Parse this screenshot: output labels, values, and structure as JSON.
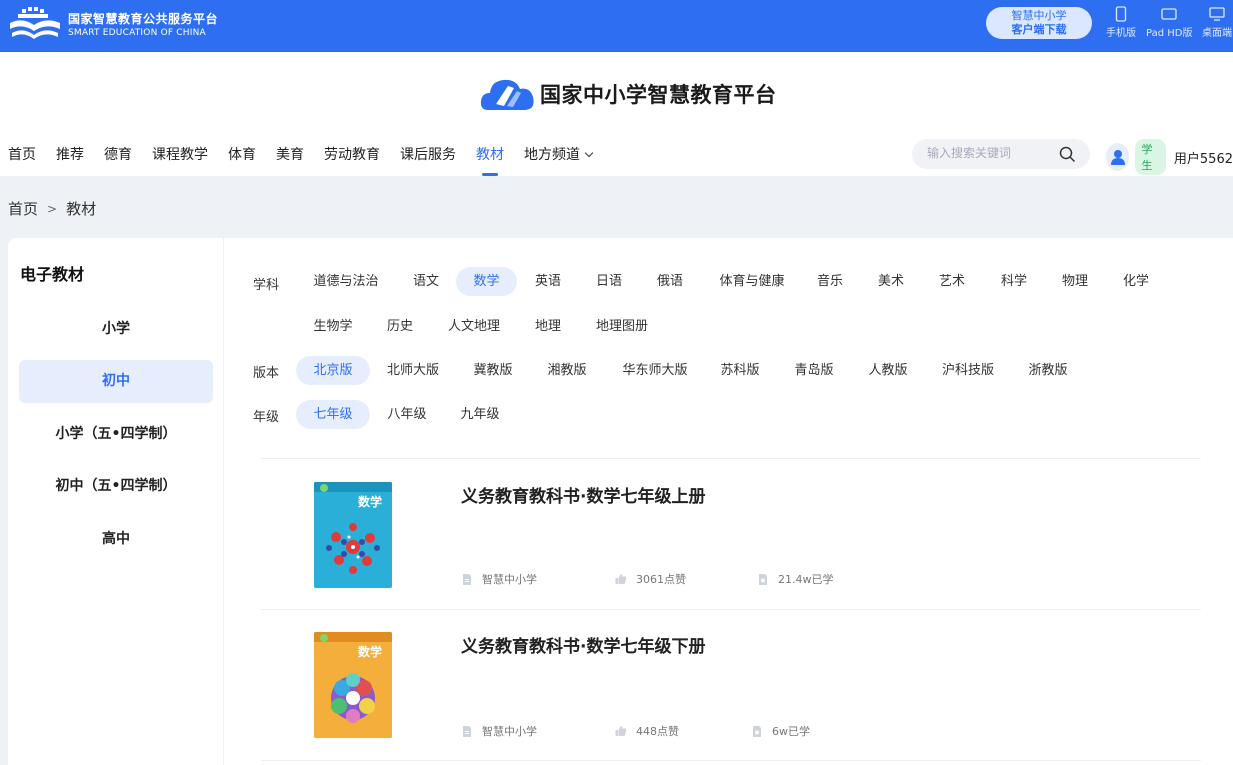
{
  "topbar": {
    "logo_cn": "国家智慧教育公共服务平台",
    "logo_en": "SMART EDUCATION OF CHINA",
    "download_line1": "智慧中小学",
    "download_line2": "客户端下载",
    "devices": [
      {
        "label": "手机版",
        "icon": "phone-icon"
      },
      {
        "label": "Pad HD版",
        "icon": "tablet-icon"
      },
      {
        "label": "桌面端",
        "icon": "desktop-icon"
      }
    ]
  },
  "header": {
    "brand_name": "国家中小学智慧教育平台",
    "nav": [
      "首页",
      "推荐",
      "德育",
      "课程教学",
      "体育",
      "美育",
      "劳动教育",
      "课后服务",
      "教材",
      "地方频道"
    ],
    "nav_active": "教材",
    "search_placeholder": "输入搜索关键词",
    "role_badge": "学生",
    "username": "用户5562"
  },
  "breadcrumb": {
    "home": "首页",
    "sep": ">",
    "current": "教材"
  },
  "sidebar": {
    "title": "电子教材",
    "items": [
      "小学",
      "初中",
      "小学（五•四学制）",
      "初中（五•四学制）",
      "高中"
    ],
    "active": "初中"
  },
  "filters": {
    "subject_label": "学科",
    "subjects": [
      "道德与法治",
      "语文",
      "数学",
      "英语",
      "日语",
      "俄语",
      "体育与健康",
      "音乐",
      "美术",
      "艺术",
      "科学",
      "物理",
      "化学",
      "生物学",
      "历史",
      "人文地理",
      "地理",
      "地理图册"
    ],
    "subject_active": "数学",
    "edition_label": "版本",
    "editions": [
      "北京版",
      "北师大版",
      "冀教版",
      "湘教版",
      "华东师大版",
      "苏科版",
      "青岛版",
      "人教版",
      "沪科技版",
      "浙教版"
    ],
    "edition_active": "北京版",
    "grade_label": "年级",
    "grades": [
      "七年级",
      "八年级",
      "九年级"
    ],
    "grade_active": "七年级"
  },
  "books": [
    {
      "title": "义务教育教科书·数学七年级上册",
      "source": "智慧中小学",
      "likes": "3061点赞",
      "learned": "21.4w已学",
      "cover_label": "数学",
      "cover_color": "#2bb1d6"
    },
    {
      "title": "义务教育教科书·数学七年级下册",
      "source": "智慧中小学",
      "likes": "448点赞",
      "learned": "6w已学",
      "cover_label": "数学",
      "cover_color": "#f0a93a"
    }
  ],
  "colors": {
    "brand_blue": "#2d6ff0",
    "active_bg": "#e6eefd"
  }
}
